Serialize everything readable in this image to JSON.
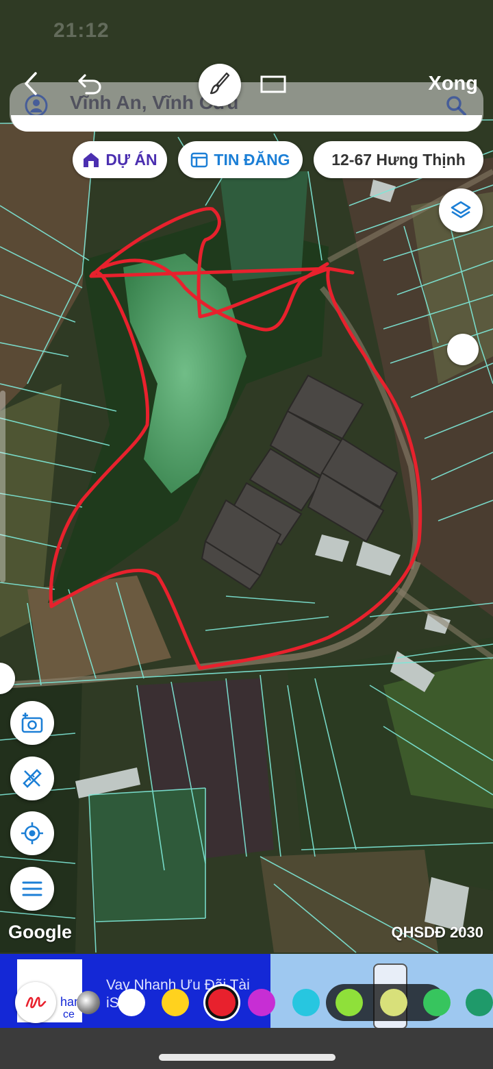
{
  "status_bar": {
    "time": "21:12"
  },
  "markup_toolbar": {
    "done_label": "Xong"
  },
  "search": {
    "query": "Vĩnh An, Vĩnh Cửu"
  },
  "chips": {
    "projects_label": "DỰ ÁN",
    "listings_label": "TIN ĐĂNG",
    "parcel_label": "12-67 Hưng Thịnh"
  },
  "map": {
    "attribution": "Google",
    "plan_label": "QHSDĐ 2030",
    "parcel_line_color": "#7ee8d8",
    "drawing_color": "#e8212d"
  },
  "ad_banner": {
    "text_line1": "Vay Nhanh Ưu Đãi Tài",
    "text_line2": "iS",
    "brand_fragment": "han",
    "brand_fragment2": "ce"
  },
  "palette": {
    "colors": [
      "#ffffff",
      "#ffd21e",
      "#e8212d",
      "#c72ed4",
      "#27c6e0",
      "#8fe03a",
      "#d8e07a",
      "#37c55e",
      "#1f9a6a"
    ],
    "selected_color": "#e8212d"
  },
  "icons": [
    "back-icon",
    "undo-icon",
    "brush-icon",
    "rectangle-icon",
    "user-icon",
    "search-icon",
    "home-project-icon",
    "calendar-list-icon",
    "layers-icon",
    "add-photo-icon",
    "measure-tool-icon",
    "locate-icon",
    "menu-icon",
    "pen-tool-icon"
  ]
}
